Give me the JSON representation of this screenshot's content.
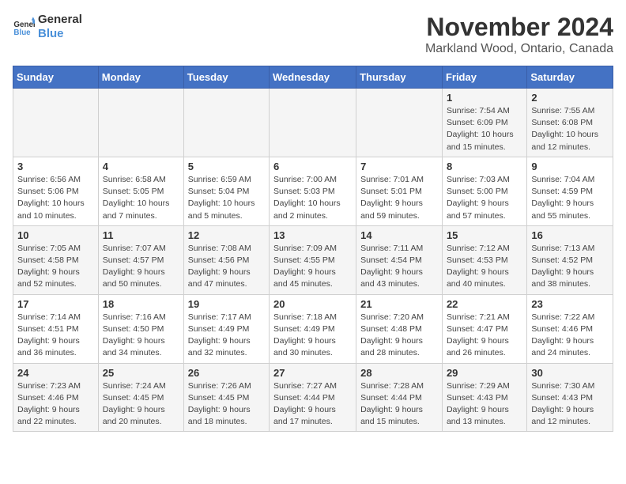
{
  "header": {
    "logo_line1": "General",
    "logo_line2": "Blue",
    "month": "November 2024",
    "location": "Markland Wood, Ontario, Canada"
  },
  "weekdays": [
    "Sunday",
    "Monday",
    "Tuesday",
    "Wednesday",
    "Thursday",
    "Friday",
    "Saturday"
  ],
  "weeks": [
    [
      {
        "day": "",
        "info": ""
      },
      {
        "day": "",
        "info": ""
      },
      {
        "day": "",
        "info": ""
      },
      {
        "day": "",
        "info": ""
      },
      {
        "day": "",
        "info": ""
      },
      {
        "day": "1",
        "info": "Sunrise: 7:54 AM\nSunset: 6:09 PM\nDaylight: 10 hours and 15 minutes."
      },
      {
        "day": "2",
        "info": "Sunrise: 7:55 AM\nSunset: 6:08 PM\nDaylight: 10 hours and 12 minutes."
      }
    ],
    [
      {
        "day": "3",
        "info": "Sunrise: 6:56 AM\nSunset: 5:06 PM\nDaylight: 10 hours and 10 minutes."
      },
      {
        "day": "4",
        "info": "Sunrise: 6:58 AM\nSunset: 5:05 PM\nDaylight: 10 hours and 7 minutes."
      },
      {
        "day": "5",
        "info": "Sunrise: 6:59 AM\nSunset: 5:04 PM\nDaylight: 10 hours and 5 minutes."
      },
      {
        "day": "6",
        "info": "Sunrise: 7:00 AM\nSunset: 5:03 PM\nDaylight: 10 hours and 2 minutes."
      },
      {
        "day": "7",
        "info": "Sunrise: 7:01 AM\nSunset: 5:01 PM\nDaylight: 9 hours and 59 minutes."
      },
      {
        "day": "8",
        "info": "Sunrise: 7:03 AM\nSunset: 5:00 PM\nDaylight: 9 hours and 57 minutes."
      },
      {
        "day": "9",
        "info": "Sunrise: 7:04 AM\nSunset: 4:59 PM\nDaylight: 9 hours and 55 minutes."
      }
    ],
    [
      {
        "day": "10",
        "info": "Sunrise: 7:05 AM\nSunset: 4:58 PM\nDaylight: 9 hours and 52 minutes."
      },
      {
        "day": "11",
        "info": "Sunrise: 7:07 AM\nSunset: 4:57 PM\nDaylight: 9 hours and 50 minutes."
      },
      {
        "day": "12",
        "info": "Sunrise: 7:08 AM\nSunset: 4:56 PM\nDaylight: 9 hours and 47 minutes."
      },
      {
        "day": "13",
        "info": "Sunrise: 7:09 AM\nSunset: 4:55 PM\nDaylight: 9 hours and 45 minutes."
      },
      {
        "day": "14",
        "info": "Sunrise: 7:11 AM\nSunset: 4:54 PM\nDaylight: 9 hours and 43 minutes."
      },
      {
        "day": "15",
        "info": "Sunrise: 7:12 AM\nSunset: 4:53 PM\nDaylight: 9 hours and 40 minutes."
      },
      {
        "day": "16",
        "info": "Sunrise: 7:13 AM\nSunset: 4:52 PM\nDaylight: 9 hours and 38 minutes."
      }
    ],
    [
      {
        "day": "17",
        "info": "Sunrise: 7:14 AM\nSunset: 4:51 PM\nDaylight: 9 hours and 36 minutes."
      },
      {
        "day": "18",
        "info": "Sunrise: 7:16 AM\nSunset: 4:50 PM\nDaylight: 9 hours and 34 minutes."
      },
      {
        "day": "19",
        "info": "Sunrise: 7:17 AM\nSunset: 4:49 PM\nDaylight: 9 hours and 32 minutes."
      },
      {
        "day": "20",
        "info": "Sunrise: 7:18 AM\nSunset: 4:49 PM\nDaylight: 9 hours and 30 minutes."
      },
      {
        "day": "21",
        "info": "Sunrise: 7:20 AM\nSunset: 4:48 PM\nDaylight: 9 hours and 28 minutes."
      },
      {
        "day": "22",
        "info": "Sunrise: 7:21 AM\nSunset: 4:47 PM\nDaylight: 9 hours and 26 minutes."
      },
      {
        "day": "23",
        "info": "Sunrise: 7:22 AM\nSunset: 4:46 PM\nDaylight: 9 hours and 24 minutes."
      }
    ],
    [
      {
        "day": "24",
        "info": "Sunrise: 7:23 AM\nSunset: 4:46 PM\nDaylight: 9 hours and 22 minutes."
      },
      {
        "day": "25",
        "info": "Sunrise: 7:24 AM\nSunset: 4:45 PM\nDaylight: 9 hours and 20 minutes."
      },
      {
        "day": "26",
        "info": "Sunrise: 7:26 AM\nSunset: 4:45 PM\nDaylight: 9 hours and 18 minutes."
      },
      {
        "day": "27",
        "info": "Sunrise: 7:27 AM\nSunset: 4:44 PM\nDaylight: 9 hours and 17 minutes."
      },
      {
        "day": "28",
        "info": "Sunrise: 7:28 AM\nSunset: 4:44 PM\nDaylight: 9 hours and 15 minutes."
      },
      {
        "day": "29",
        "info": "Sunrise: 7:29 AM\nSunset: 4:43 PM\nDaylight: 9 hours and 13 minutes."
      },
      {
        "day": "30",
        "info": "Sunrise: 7:30 AM\nSunset: 4:43 PM\nDaylight: 9 hours and 12 minutes."
      }
    ]
  ]
}
